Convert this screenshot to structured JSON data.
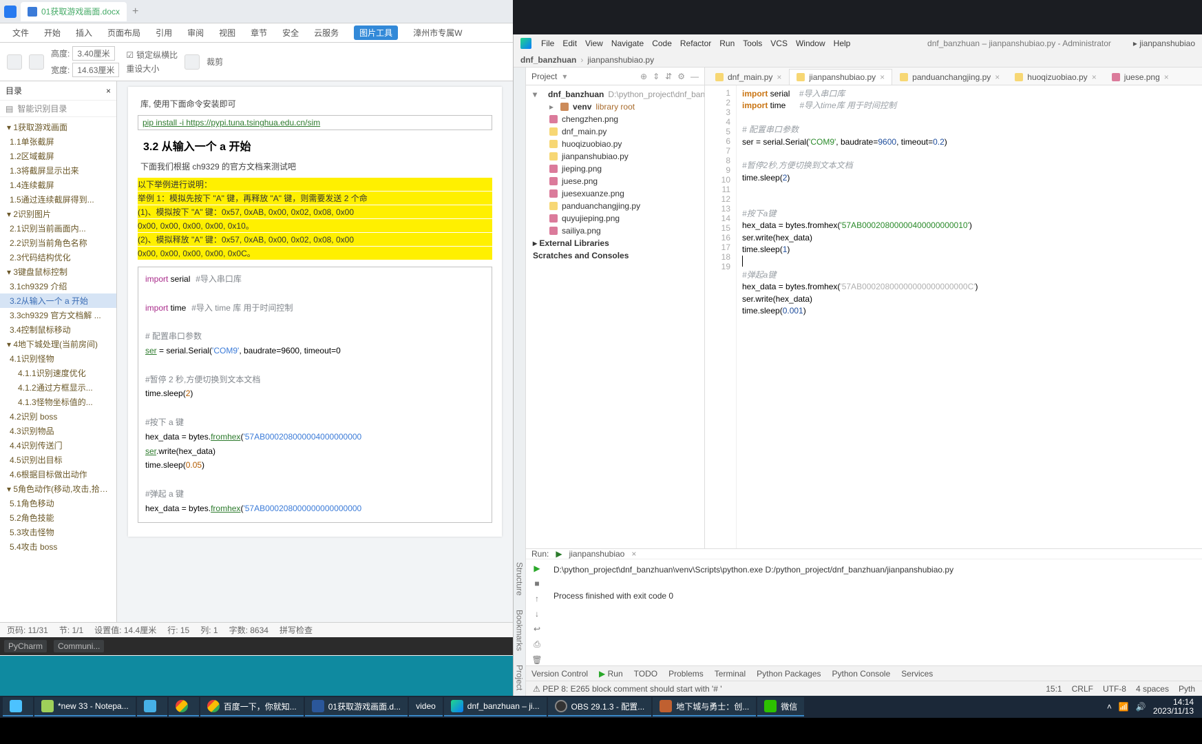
{
  "wps": {
    "tab_title": "01获取游戏画面.docx",
    "ribbon": [
      "文件",
      "开始",
      "插入",
      "页面布局",
      "引用",
      "审阅",
      "视图",
      "章节",
      "安全",
      "云服务",
      "图片工具",
      "漳州市专属W"
    ],
    "ribbon_active_index": 10,
    "toolbar": {
      "height_label": "高度:",
      "height_val": "3.40厘米",
      "width_label": "宽度:",
      "width_val": "14.63厘米",
      "lock_ratio": "锁定纵横比",
      "reset_size": "重设大小",
      "crop": "裁剪"
    },
    "outline": {
      "title": "目录",
      "smart": "智能识别目录",
      "items": [
        {
          "lvl": 1,
          "t": "1获取游戏画面"
        },
        {
          "lvl": 2,
          "t": "1.1单张截屏"
        },
        {
          "lvl": 2,
          "t": "1.2区域截屏"
        },
        {
          "lvl": 2,
          "t": "1.3将截屏显示出来"
        },
        {
          "lvl": 2,
          "t": "1.4连续截屏"
        },
        {
          "lvl": 2,
          "t": "1.5通过连续截屏得到..."
        },
        {
          "lvl": 1,
          "t": "2识别图片"
        },
        {
          "lvl": 2,
          "t": "2.1识别当前画面内..."
        },
        {
          "lvl": 2,
          "t": "2.2识别当前角色名称"
        },
        {
          "lvl": 2,
          "t": "2.3代码结构优化"
        },
        {
          "lvl": 1,
          "t": "3键盘鼠标控制"
        },
        {
          "lvl": 2,
          "t": "3.1ch9329 介绍"
        },
        {
          "lvl": 2,
          "t": "3.2从输入一个 a 开始",
          "sel": true
        },
        {
          "lvl": 2,
          "t": "3.3ch9329 官方文档解 ..."
        },
        {
          "lvl": 2,
          "t": "3.4控制鼠标移动"
        },
        {
          "lvl": 1,
          "t": "4地下城处理(当前房间)"
        },
        {
          "lvl": 2,
          "t": "4.1识别怪物"
        },
        {
          "lvl": 3,
          "t": "4.1.1识别速度优化"
        },
        {
          "lvl": 3,
          "t": "4.1.2通过方框显示..."
        },
        {
          "lvl": 3,
          "t": "4.1.3怪物坐标值的..."
        },
        {
          "lvl": 2,
          "t": "4.2识别 boss"
        },
        {
          "lvl": 2,
          "t": "4.3识别物品"
        },
        {
          "lvl": 2,
          "t": "4.4识别传送门"
        },
        {
          "lvl": 2,
          "t": "4.5识别出目标"
        },
        {
          "lvl": 2,
          "t": "4.6根据目标做出动作"
        },
        {
          "lvl": 1,
          "t": "5角色动作(移动,攻击,拾取..."
        },
        {
          "lvl": 2,
          "t": "5.1角色移动"
        },
        {
          "lvl": 2,
          "t": "5.2角色技能"
        },
        {
          "lvl": 2,
          "t": "5.3攻击怪物"
        },
        {
          "lvl": 2,
          "t": "5.4攻击 boss"
        }
      ]
    },
    "doc": {
      "pip_prefix": "库, 使用下面命令安装即可",
      "pip_cmd": "pip install -i https://pypi.tuna.tsinghua.edu.cn/sim",
      "h2": "3.2  从输入一个 a 开始",
      "intro": "下面我们根据 ch9329 的官方文档来测试吧",
      "hl": [
        "以下举例进行说明：",
        "举例 1：模拟先按下 \"A\" 键，再释放 \"A\" 键，则需要发送 2 个命",
        "(1)、模拟按下 \"A\" 键：0x57, 0xAB, 0x00, 0x02, 0x08, 0x00",
        "0x00, 0x00, 0x00, 0x00, 0x10。",
        "(2)、模拟释放 \"A\" 键：0x57, 0xAB, 0x00, 0x02, 0x08, 0x00",
        "0x00, 0x00, 0x00, 0x00, 0x0C。"
      ],
      "code": {
        "l1a": "import",
        "l1b": " serial",
        "l1c": "#导入串口库",
        "l2a": "import",
        "l2b": " time",
        "l2c": "#导入 time 库  用于时间控制",
        "l3": "# 配置串口参数",
        "l4a": "ser",
        "l4b": " = serial.Serial(",
        "l4c": "'COM9'",
        "l4d": ", baudrate=9600, timeout=0",
        "l5": "#暂停 2 秒,方便切换到文本文档",
        "l6a": "time.sleep(",
        "l6b": "2",
        "l6c": ")",
        "l7": "#按下 a 键",
        "l8a": "hex_data = bytes.",
        "l8b": "fromhex",
        "l8c": "(",
        "l8d": "'57AB000208000004000000000",
        "l9a": "ser",
        "l9b": ".write(hex_data)",
        "l10a": "time.sleep(",
        "l10b": "0.05",
        "l10c": ")",
        "l11": "#弹起 a 键",
        "l12a": "hex_data = bytes.",
        "l12b": "fromhex",
        "l12c": "(",
        "l12d": "'57AB000208000000000000000"
      }
    },
    "status": {
      "page": "页码: 11/31",
      "sec": "节: 1/1",
      "pos": "设置值: 14.4厘米",
      "line": "行: 15",
      "col": "列: 1",
      "chars": "字数: 8634",
      "spell": "拼写检查"
    }
  },
  "strip": {
    "a": "PyCharm",
    "b": "Communi..."
  },
  "pycharm": {
    "menu": [
      "File",
      "Edit",
      "View",
      "Navigate",
      "Code",
      "Refactor",
      "Run",
      "Tools",
      "VCS",
      "Window",
      "Help"
    ],
    "title": "dnf_banzhuan – jianpanshubiao.py - Administrator",
    "run_config": "jianpanshubiao",
    "crumb": {
      "proj": "dnf_banzhuan",
      "file": "jianpanshubiao.py"
    },
    "project": {
      "label": "Project",
      "root": "dnf_banzhuan",
      "root_hint": "D:\\python_project\\dnf_banzh",
      "venv": "venv",
      "venv_hint": "library root",
      "files": [
        {
          "n": "chengzhen.png",
          "k": "png"
        },
        {
          "n": "dnf_main.py",
          "k": "py"
        },
        {
          "n": "huoqizuobiao.py",
          "k": "py"
        },
        {
          "n": "jianpanshubiao.py",
          "k": "py"
        },
        {
          "n": "jieping.png",
          "k": "png"
        },
        {
          "n": "juese.png",
          "k": "png"
        },
        {
          "n": "juesexuanze.png",
          "k": "png"
        },
        {
          "n": "panduanchangjing.py",
          "k": "py"
        },
        {
          "n": "quyujieping.png",
          "k": "png"
        },
        {
          "n": "sailiya.png",
          "k": "png"
        }
      ],
      "ext": "External Libraries",
      "scratch": "Scratches and Consoles"
    },
    "tabs": [
      {
        "n": "dnf_main.py",
        "k": "py"
      },
      {
        "n": "jianpanshubiao.py",
        "k": "py",
        "active": true
      },
      {
        "n": "panduanchangjing.py",
        "k": "py"
      },
      {
        "n": "huoqizuobiao.py",
        "k": "py"
      },
      {
        "n": "juese.png",
        "k": "png"
      }
    ],
    "code_lines": 19,
    "code": {
      "l1": {
        "a": "import",
        "b": " serial    ",
        "c": "#导入串口库"
      },
      "l2": {
        "a": "import",
        "b": " time      ",
        "c": "#导入time库 用于时间控制"
      },
      "l3": "",
      "l4": "# 配置串口参数",
      "l5": {
        "a": "ser = serial.Serial(",
        "b": "'COM9'",
        "c": ", baudrate=",
        "d": "9600",
        "e": ", timeout=",
        "f": "0.2",
        "g": ")"
      },
      "l6": "",
      "l7": "#暂停2秒,方便切换到文本文档",
      "l8": {
        "a": "time.sleep(",
        "b": "2",
        "c": ")"
      },
      "l9": "",
      "l10": "",
      "l11": "#按下a键",
      "l12": {
        "a": "hex_data = bytes.fromhex(",
        "b": "'57AB00020800000400000000010'",
        "c": ")"
      },
      "l13": "ser.write(hex_data)",
      "l14": {
        "a": "time.sleep(",
        "b": "1",
        "c": ")"
      },
      "l15": "",
      "l16": "#弹起a键",
      "l17": {
        "a": "hex_data = bytes.fromhex(",
        "b": "'57AB00020800000000000000000C'",
        "c": ")"
      },
      "l18": "ser.write(hex_data)",
      "l19": {
        "a": "time.sleep(",
        "b": "0.001",
        "c": ")"
      }
    },
    "run": {
      "label": "Run:",
      "tab": "jianpanshubiao",
      "out1": "D:\\python_project\\dnf_banzhuan\\venv\\Scripts\\python.exe D:/python_project/dnf_banzhuan/jianpanshubiao.py",
      "out2": "Process finished with exit code 0"
    },
    "bottom": [
      "Version Control",
      "Run",
      "TODO",
      "Problems",
      "Terminal",
      "Python Packages",
      "Python Console",
      "Services"
    ],
    "status": {
      "pep": "PEP 8: E265 block comment should start with '# '",
      "pos": "15:1",
      "crlf": "CRLF",
      "enc": "UTF-8",
      "indent": "4 spaces",
      "lang": "Pyth"
    }
  },
  "taskbar": {
    "items": [
      {
        "icon": "win",
        "t": ""
      },
      {
        "icon": "np",
        "t": "*new 33 - Notepa..."
      },
      {
        "icon": "edge",
        "t": ""
      },
      {
        "icon": "chrome",
        "t": ""
      },
      {
        "icon": "chrome",
        "t": "百度一下，你就知..."
      },
      {
        "icon": "word",
        "t": "01获取游戏画面.d..."
      },
      {
        "icon": "",
        "t": "video"
      },
      {
        "icon": "pyc",
        "t": "dnf_banzhuan – ji..."
      },
      {
        "icon": "obs",
        "t": "OBS 29.1.3 - 配置..."
      },
      {
        "icon": "dnf",
        "t": "地下城与勇士：创..."
      },
      {
        "icon": "wx",
        "t": "微信"
      }
    ],
    "time": "14:14",
    "date": "2023/11/13"
  }
}
